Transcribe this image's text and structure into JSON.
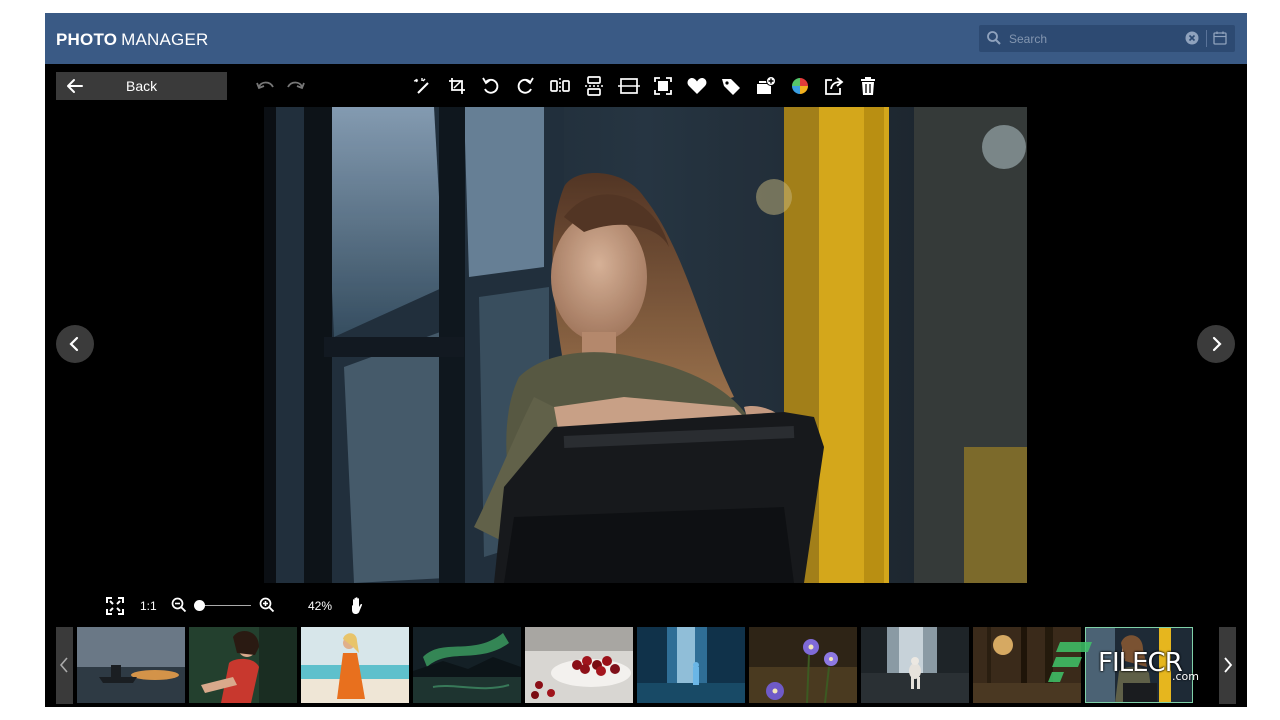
{
  "app": {
    "brand_bold": "PHOTO",
    "brand_light": "MANAGER",
    "search_placeholder": "Search",
    "accent_color": "#3a5a85"
  },
  "toolbar": {
    "back_label": "Back",
    "tools": [
      "magic-wand-icon",
      "crop-icon",
      "rotate-left-icon",
      "rotate-right-icon",
      "flip-horizontal-icon",
      "flip-vertical-icon",
      "aspect-ratio-icon",
      "frame-icon",
      "favorite-heart-icon",
      "tag-icon",
      "add-to-album-icon",
      "color-palette-icon",
      "share-icon",
      "trash-icon"
    ]
  },
  "viewer": {
    "zoom_one_to_one": "1:1",
    "zoom_percent": "42%",
    "zoom_level": 0.12
  },
  "filmstrip": {
    "thumbnails": [
      "ship-sunset",
      "woman-red-dress",
      "woman-beach-orange",
      "aurora-lake",
      "cherries-bowl",
      "waterfall-figure",
      "purple-flowers",
      "dog-waterfall",
      "forest-sunlight",
      "woman-bus"
    ],
    "selected_index": 9
  },
  "watermark": {
    "text": "FILECR",
    "suffix": ".com"
  }
}
